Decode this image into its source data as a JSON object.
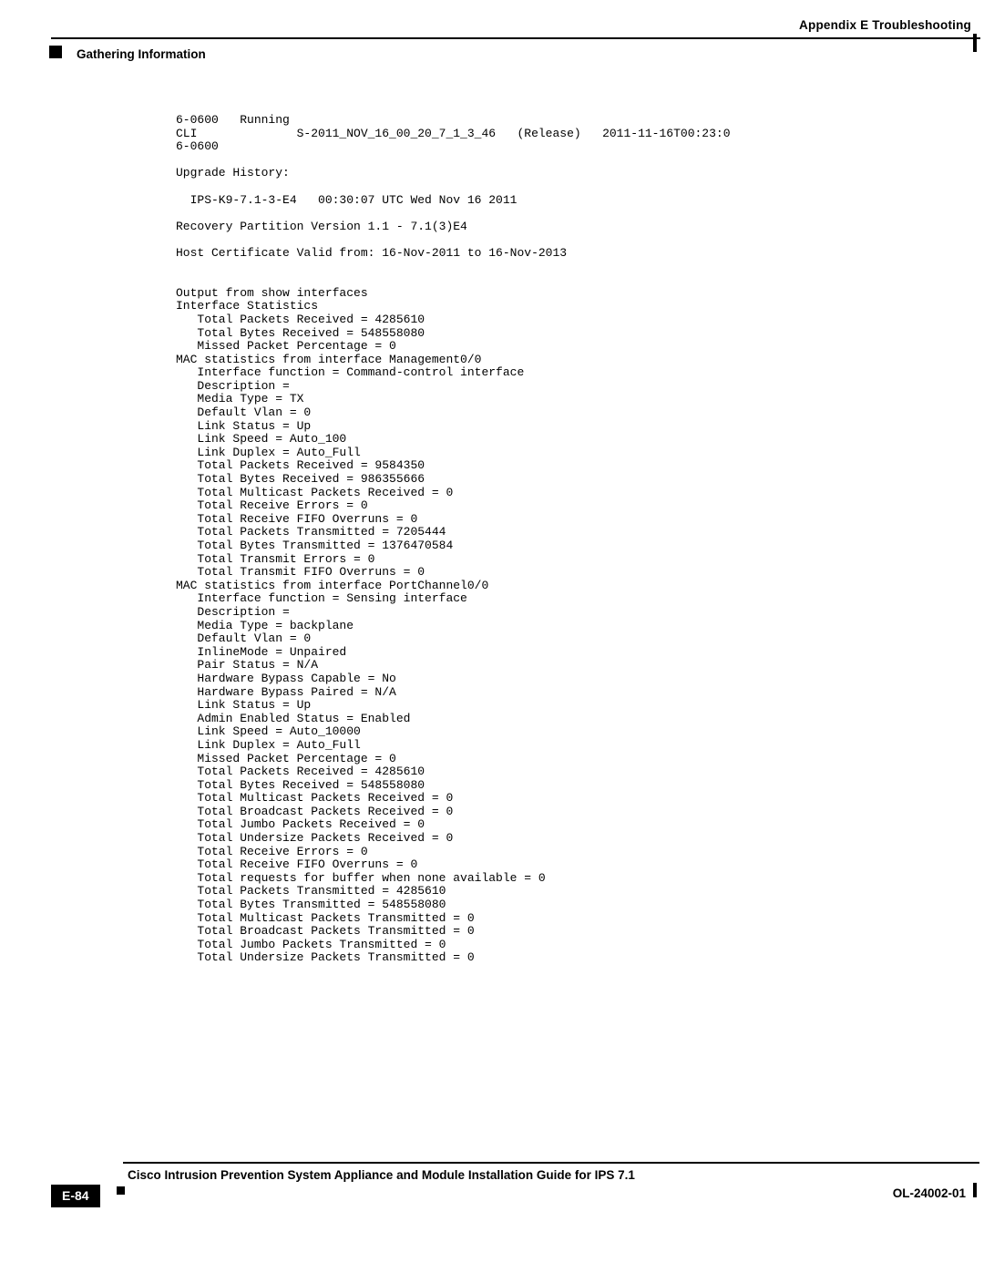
{
  "header": {
    "appendix": "Appendix E      Troubleshooting",
    "section": "Gathering Information"
  },
  "terminal": {
    "lines": [
      "6-0600   Running",
      "CLI              S-2011_NOV_16_00_20_7_1_3_46   (Release)   2011-11-16T00:23:0",
      "6-0600",
      "",
      "Upgrade History:",
      "",
      "  IPS-K9-7.1-3-E4   00:30:07 UTC Wed Nov 16 2011",
      "",
      "Recovery Partition Version 1.1 - 7.1(3)E4",
      "",
      "Host Certificate Valid from: 16-Nov-2011 to 16-Nov-2013",
      "",
      "",
      "Output from show interfaces",
      "Interface Statistics",
      "   Total Packets Received = 4285610",
      "   Total Bytes Received = 548558080",
      "   Missed Packet Percentage = 0",
      "MAC statistics from interface Management0/0",
      "   Interface function = Command-control interface",
      "   Description =",
      "   Media Type = TX",
      "   Default Vlan = 0",
      "   Link Status = Up",
      "   Link Speed = Auto_100",
      "   Link Duplex = Auto_Full",
      "   Total Packets Received = 9584350",
      "   Total Bytes Received = 986355666",
      "   Total Multicast Packets Received = 0",
      "   Total Receive Errors = 0",
      "   Total Receive FIFO Overruns = 0",
      "   Total Packets Transmitted = 7205444",
      "   Total Bytes Transmitted = 1376470584",
      "   Total Transmit Errors = 0",
      "   Total Transmit FIFO Overruns = 0",
      "MAC statistics from interface PortChannel0/0",
      "   Interface function = Sensing interface",
      "   Description =",
      "   Media Type = backplane",
      "   Default Vlan = 0",
      "   InlineMode = Unpaired",
      "   Pair Status = N/A",
      "   Hardware Bypass Capable = No",
      "   Hardware Bypass Paired = N/A",
      "   Link Status = Up",
      "   Admin Enabled Status = Enabled",
      "   Link Speed = Auto_10000",
      "   Link Duplex = Auto_Full",
      "   Missed Packet Percentage = 0",
      "   Total Packets Received = 4285610",
      "   Total Bytes Received = 548558080",
      "   Total Multicast Packets Received = 0",
      "   Total Broadcast Packets Received = 0",
      "   Total Jumbo Packets Received = 0",
      "   Total Undersize Packets Received = 0",
      "   Total Receive Errors = 0",
      "   Total Receive FIFO Overruns = 0",
      "   Total requests for buffer when none available = 0",
      "   Total Packets Transmitted = 4285610",
      "   Total Bytes Transmitted = 548558080",
      "   Total Multicast Packets Transmitted = 0",
      "   Total Broadcast Packets Transmitted = 0",
      "   Total Jumbo Packets Transmitted = 0",
      "   Total Undersize Packets Transmitted = 0"
    ]
  },
  "footer": {
    "doc_title": "Cisco Intrusion Prevention System Appliance and Module Installation Guide for IPS 7.1",
    "page_number": "E-84",
    "doc_id": "OL-24002-01"
  }
}
